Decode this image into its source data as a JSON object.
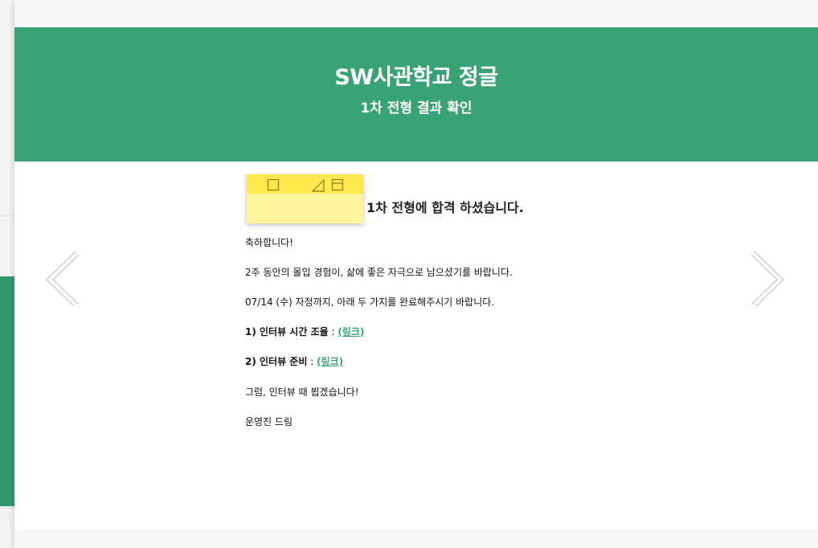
{
  "header": {
    "title": "SW사관학교 정글",
    "subtitle": "1차 전형 결과 확인"
  },
  "message": {
    "headline": "1차 전형에 합격 하셨습니다.",
    "congrats": "축하합니다!",
    "wish": "2주 동안의 몰입 경험이, 삶에 좋은 자극으로 남으셨기를 바랍니다.",
    "deadline": "07/14 (수) 자정까지, 아래 두 가지를 완료해주시기 바랍니다.",
    "item1_label": "1) 인터뷰 시간 조율",
    "item2_label": "2) 인터뷰 준비",
    "separator": " : ",
    "link_text": "(링크)",
    "closing": "그럼, 인터뷰 때 뵙겠습니다!",
    "signature": "운영진 드림"
  },
  "colors": {
    "accent": "#3aa376",
    "sticky_bar": "#ffe94d",
    "sticky_body": "#fff59d"
  },
  "icons": {
    "prev": "chevron-left-icon",
    "next": "chevron-right-icon",
    "sticky_new": "square-icon",
    "sticky_resize": "triangle-icon",
    "sticky_window": "window-icon"
  }
}
